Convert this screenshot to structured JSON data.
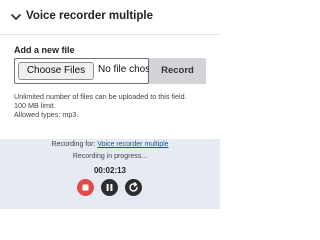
{
  "header": {
    "title": "Voice recorder multiple",
    "toggle_icon": "chevron-down-icon"
  },
  "field": {
    "label": "Add a new file",
    "choose_button": "Choose Files",
    "no_file_text": "No file chosen",
    "record_button": "Record"
  },
  "description": {
    "line1": "Unlimited number of files can be uploaded to this field.",
    "line2": "100 MB limit.",
    "line3": "Allowed types: mp3."
  },
  "recorder": {
    "recording_for_prefix": "Recording for:",
    "recording_for_target": "Voice recorder multiple",
    "status": "Recording in progress...",
    "timer": "00:02:13",
    "controls": {
      "stop_icon": "stop-icon",
      "pause_icon": "pause-icon",
      "reset_icon": "reset-icon"
    }
  },
  "colors": {
    "recorder_bg": "#e6ebf3",
    "stop": "#e24b4b",
    "control_dark": "#2d2d2f",
    "link": "#1a4fa3",
    "record_button_bg": "#d4d4d8"
  }
}
